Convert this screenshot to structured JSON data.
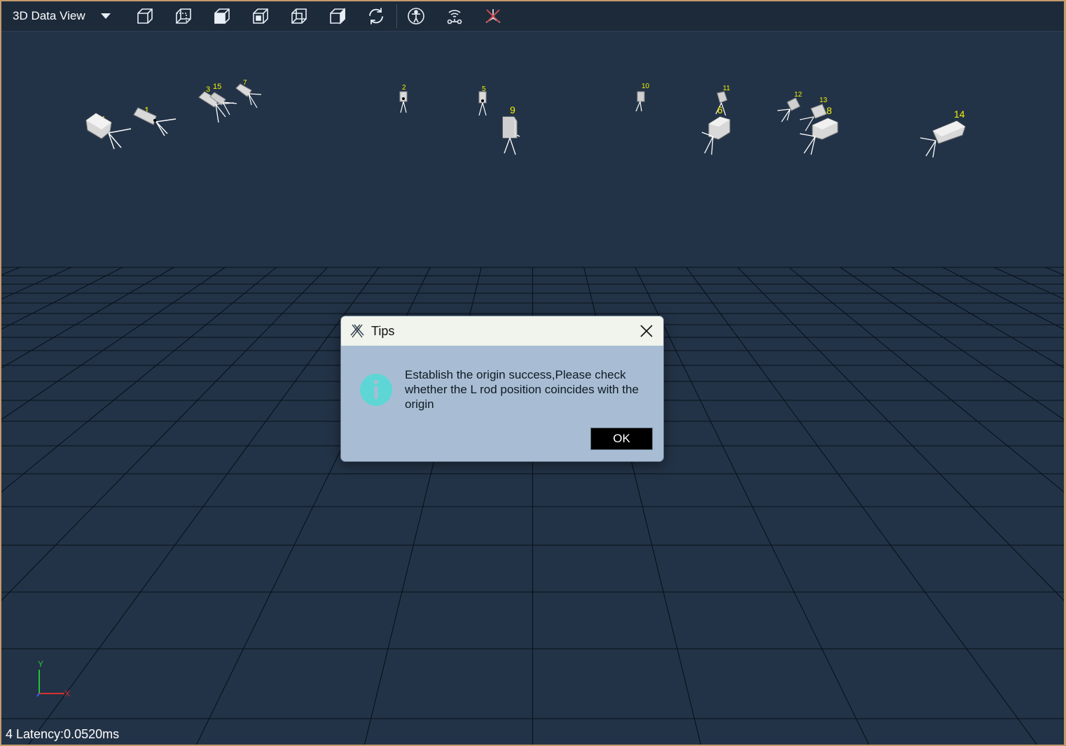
{
  "window": {
    "view_selector": {
      "label": "3D Data View",
      "icon": "chevron-down-icon"
    },
    "toolbar_buttons": [
      {
        "name": "view-front-button",
        "icon": "cube-front-icon"
      },
      {
        "name": "view-back-button",
        "icon": "cube-back-icon"
      },
      {
        "name": "view-left-button",
        "icon": "cube-left-icon"
      },
      {
        "name": "view-right-button",
        "icon": "cube-right-icon"
      },
      {
        "name": "view-top-button",
        "icon": "cube-top-icon"
      },
      {
        "name": "view-bottom-button",
        "icon": "cube-bottom-icon"
      },
      {
        "name": "reset-view-button",
        "icon": "refresh-icon"
      },
      {
        "name": "skeleton-button",
        "icon": "human-figure-icon"
      },
      {
        "name": "rigid-body-button",
        "icon": "wireless-tracker-icon"
      },
      {
        "name": "axis-toggle-button",
        "icon": "axes-icon"
      }
    ],
    "colors": {
      "accent_icon": "#c64a4a",
      "icon": "#e8eef5",
      "scene_background": "#233347",
      "camera_label": "#f2f200"
    }
  },
  "scene": {
    "cameras": [
      {
        "id": "1",
        "label": "1"
      },
      {
        "id": "2",
        "label": "2"
      },
      {
        "id": "3",
        "label": "3"
      },
      {
        "id": "4",
        "label": "4"
      },
      {
        "id": "5",
        "label": "5"
      },
      {
        "id": "6",
        "label": "6"
      },
      {
        "id": "7",
        "label": "7"
      },
      {
        "id": "8",
        "label": "8"
      },
      {
        "id": "9",
        "label": "9"
      },
      {
        "id": "10",
        "label": "10"
      },
      {
        "id": "11",
        "label": "11"
      },
      {
        "id": "12",
        "label": "12"
      },
      {
        "id": "13",
        "label": "13"
      },
      {
        "id": "14",
        "label": "14"
      },
      {
        "id": "15",
        "label": "15"
      }
    ],
    "axis_labels": {
      "y": "Y",
      "x": "X"
    },
    "status": {
      "latency_text": "4 Latency:0.0520ms"
    }
  },
  "dialog": {
    "title": "Tips",
    "message": "Establish the origin success,Please check whether the L rod position coincides with the origin",
    "ok_label": "OK",
    "icons": {
      "logo": "app-logo-icon",
      "info": "info-icon",
      "close": "close-icon"
    },
    "colors": {
      "info_circle": "#5fd6d6",
      "ok_background": "#000000"
    }
  }
}
